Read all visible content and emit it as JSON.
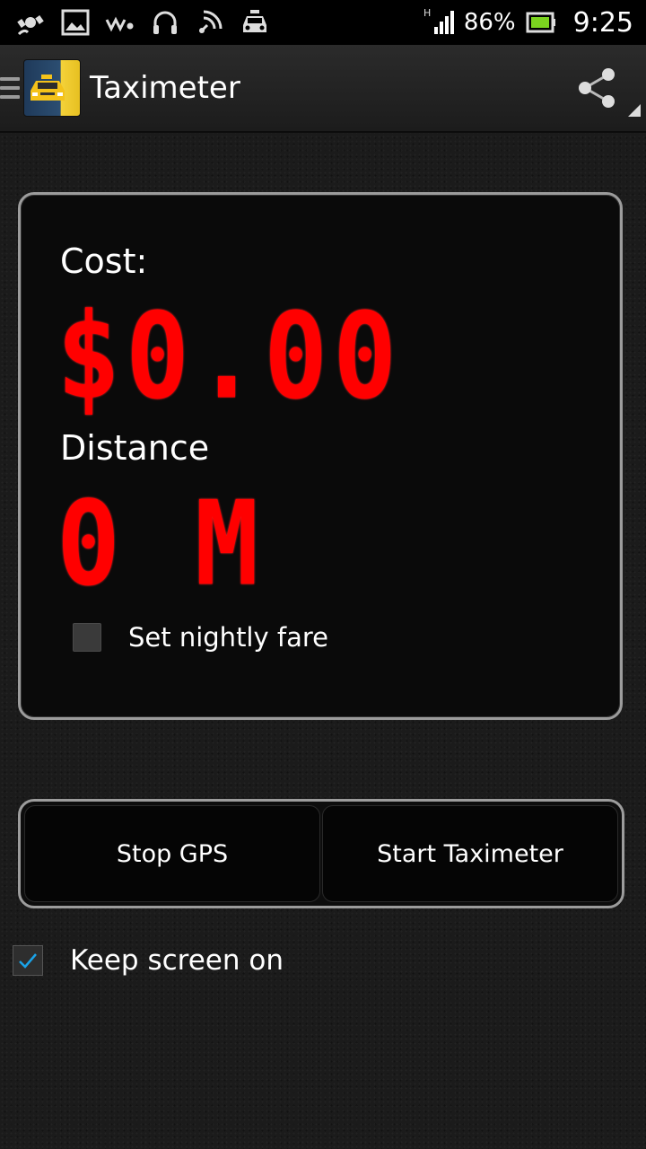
{
  "status_bar": {
    "icons": [
      "gps-icon",
      "image-icon",
      "walkman-icon",
      "headphones-icon",
      "nfc-icon",
      "car-icon"
    ],
    "network": "H",
    "battery_percent": "86%",
    "time": "9:25"
  },
  "action_bar": {
    "title": "Taximeter",
    "share_icon": "share-icon"
  },
  "meter": {
    "cost_label": "Cost:",
    "cost_value": "$0.00",
    "distance_label": "Distance",
    "distance_value": "0 M",
    "night_fare_label": "Set nightly fare",
    "night_fare_checked": false
  },
  "buttons": {
    "stop_gps": "Stop GPS",
    "start_taximeter": "Start Taximeter"
  },
  "keep_screen": {
    "label": "Keep screen on",
    "checked": true
  },
  "colors": {
    "digital_red": "#ff0000",
    "check_blue": "#1aa3e8"
  }
}
